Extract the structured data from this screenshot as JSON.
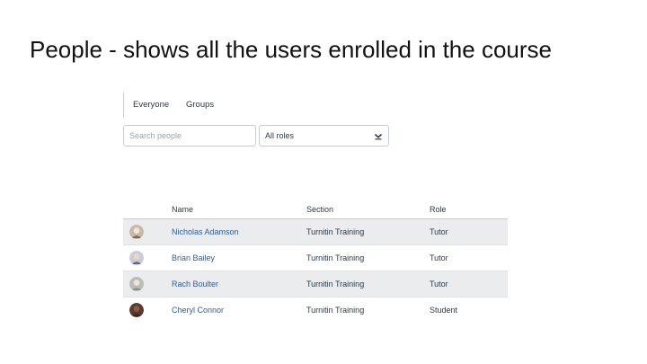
{
  "slide": {
    "title": "People - shows all the users enrolled in the course"
  },
  "tabs": [
    {
      "label": "Everyone",
      "active": true
    },
    {
      "label": "Groups",
      "active": false
    }
  ],
  "filters": {
    "search_placeholder": "Search people",
    "role_selected": "All roles"
  },
  "table": {
    "headers": {
      "name": "Name",
      "section": "Section",
      "role": "Role"
    },
    "rows": [
      {
        "name": "Nicholas Adamson",
        "section": "Turnitin Training",
        "role": "Tutor"
      },
      {
        "name": "Brian Bailey",
        "section": "Turnitin Training",
        "role": "Tutor"
      },
      {
        "name": "Rach Boulter",
        "section": "Turnitin Training",
        "role": "Tutor"
      },
      {
        "name": "Cheryl Connor",
        "section": "Turnitin Training",
        "role": "Student"
      }
    ]
  },
  "colors": {
    "link": "#2d5f99",
    "row_shade": "#eaecee",
    "border": "#c7cdd1"
  },
  "icons": [
    "chevron-down-icon",
    "avatar"
  ]
}
